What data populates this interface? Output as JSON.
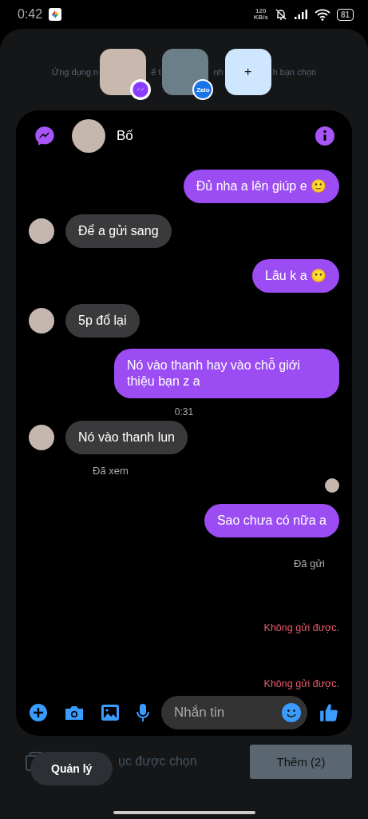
{
  "status_bar": {
    "time": "0:42",
    "speed_value": "120",
    "speed_unit": "KB/s",
    "battery": "81"
  },
  "app_picker": {
    "hint_fragments": [
      "Ứng dụng n",
      "ể t",
      "nh",
      "h bạn chọn"
    ],
    "apps": [
      {
        "kind": "messenger"
      },
      {
        "kind": "zalo",
        "badge": "Zalo"
      }
    ],
    "add_label": "+"
  },
  "chat": {
    "contact": "Bố",
    "messages": [
      {
        "kind": "out",
        "text": "Đủ nha a lên giúp e 🙂"
      },
      {
        "kind": "in",
        "text": "Để a gửi sang"
      },
      {
        "kind": "out",
        "text": "Lâu k a 😶"
      },
      {
        "kind": "in",
        "text": "5p đổ lại"
      },
      {
        "kind": "out",
        "text": "Nó vào thanh hay vào chỗ giới thiệu bạn z a"
      },
      {
        "kind": "time",
        "text": "0:31"
      },
      {
        "kind": "in",
        "text": "Nó vào thanh lun"
      },
      {
        "kind": "seen",
        "text": "Đã xem"
      },
      {
        "kind": "read-avatar"
      },
      {
        "kind": "out",
        "text": "Sao chưa có nữa a"
      },
      {
        "kind": "sent",
        "text": "Đã gửi"
      },
      {
        "kind": "error",
        "text": "Không gửi được."
      },
      {
        "kind": "error",
        "text": "Không gửi được."
      }
    ],
    "composer": {
      "placeholder": "Nhắn tin"
    }
  },
  "bottom": {
    "selection_fragment": "ục được chọn",
    "manage": "Quản lý",
    "add_button": "Thêm (2)"
  }
}
